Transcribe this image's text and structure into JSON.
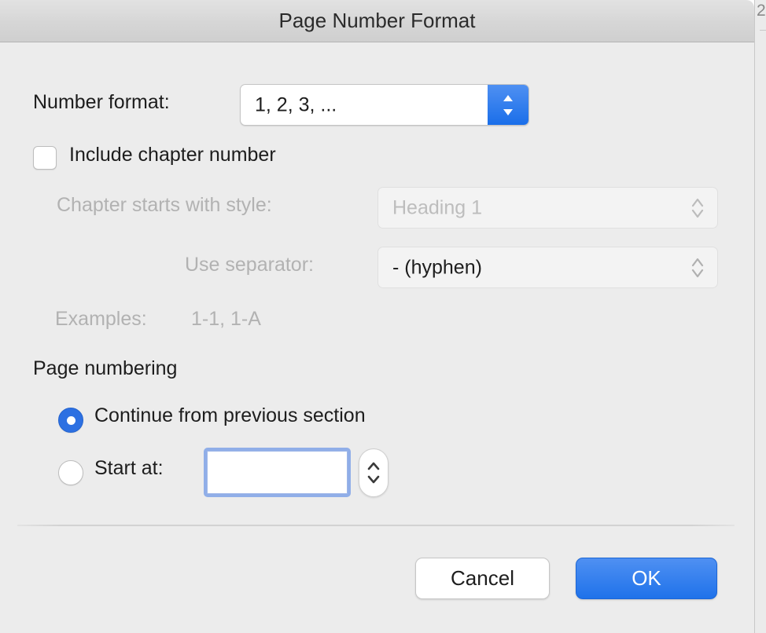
{
  "background": {
    "page_number": "2"
  },
  "dialog": {
    "title": "Page Number Format",
    "number_format": {
      "label": "Number format:",
      "value": "1, 2, 3, ...",
      "chevron_icon": "chevron-up-down-icon"
    },
    "include_chapter_number": {
      "label": "Include chapter number",
      "checked": "false",
      "checkbox_icon": "checkbox-unchecked-icon"
    },
    "chapter_starts_with_style": {
      "label": "Chapter starts with style:",
      "value": "Heading 1",
      "disabled": "true",
      "chevron_icon": "chevron-up-down-icon"
    },
    "use_separator": {
      "label": "Use separator:",
      "value": "-        (hyphen)",
      "disabled": "true",
      "chevron_icon": "chevron-up-down-icon"
    },
    "examples": {
      "label": "Examples:",
      "value": "1-1, 1-A"
    },
    "page_numbering": {
      "heading": "Page numbering",
      "options": [
        {
          "label": "Continue from previous section",
          "selected": "true"
        },
        {
          "label": "Start at:",
          "selected": "false"
        }
      ],
      "start_at_value": "",
      "stepper_icon": "stepper-up-down-icon"
    },
    "footer": {
      "cancel_label": "Cancel",
      "ok_label": "OK"
    }
  },
  "colors": {
    "accent_blue": "#2d70e2",
    "popup_blue_top": "#4f90f2",
    "popup_blue_bottom": "#1a6ee9",
    "dialog_background": "#ececec",
    "titlebar_top": "#e2e2e2",
    "disabled_text": "#b2b2b2",
    "focus_ring": "#90aee8"
  }
}
